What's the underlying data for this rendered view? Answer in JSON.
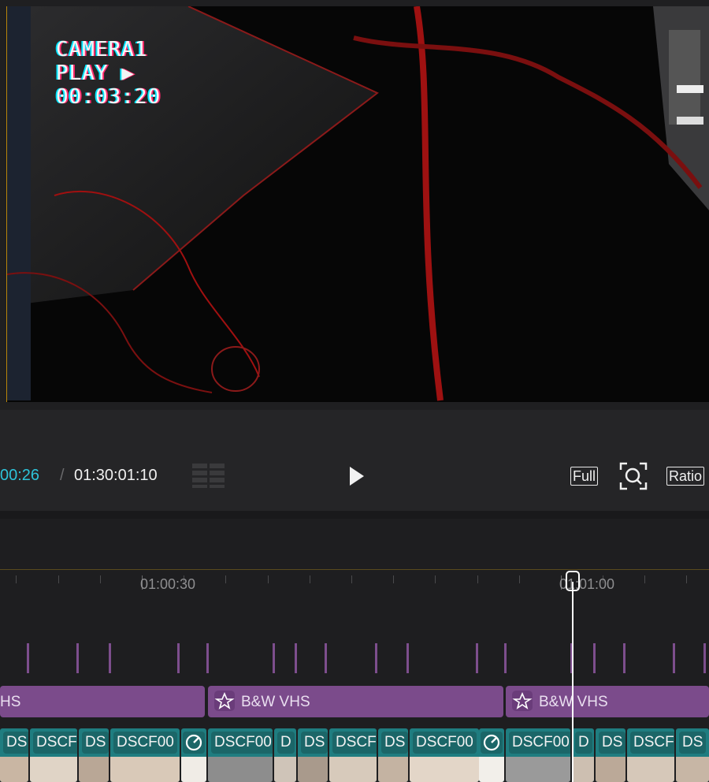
{
  "preview": {
    "osd_lines": [
      "CAMERA1",
      "PLAY ▶",
      "00:03:20"
    ]
  },
  "controls": {
    "current_time": "00:26",
    "separator": "/",
    "total_time": "01:30:01:10",
    "full_label": "Full",
    "ratio_label": "Ratio"
  },
  "ruler": {
    "labels": [
      "01:00:30",
      "01:01:00"
    ]
  },
  "effects": {
    "clips": [
      "HS",
      "B&W VHS",
      "B&W VHS"
    ]
  },
  "video": {
    "clips": [
      "DS",
      "DSCF",
      "DS",
      "DSCF00",
      "",
      "DSCF00",
      "D",
      "DS",
      "DSCF",
      "DS",
      "DSCF00",
      "",
      "DSCF00",
      "D",
      "DS",
      "DSCF",
      "DS"
    ]
  },
  "colors": {
    "accent_time": "#2ec3d9",
    "effect_track": "#7b4b8b",
    "video_track": "#1f7d80",
    "playhead": "#ffffff"
  },
  "icons": [
    "play-icon",
    "fullscreen-focus-icon",
    "layout-grid-icon",
    "effect-sparkle-icon",
    "speed-gauge-icon"
  ]
}
